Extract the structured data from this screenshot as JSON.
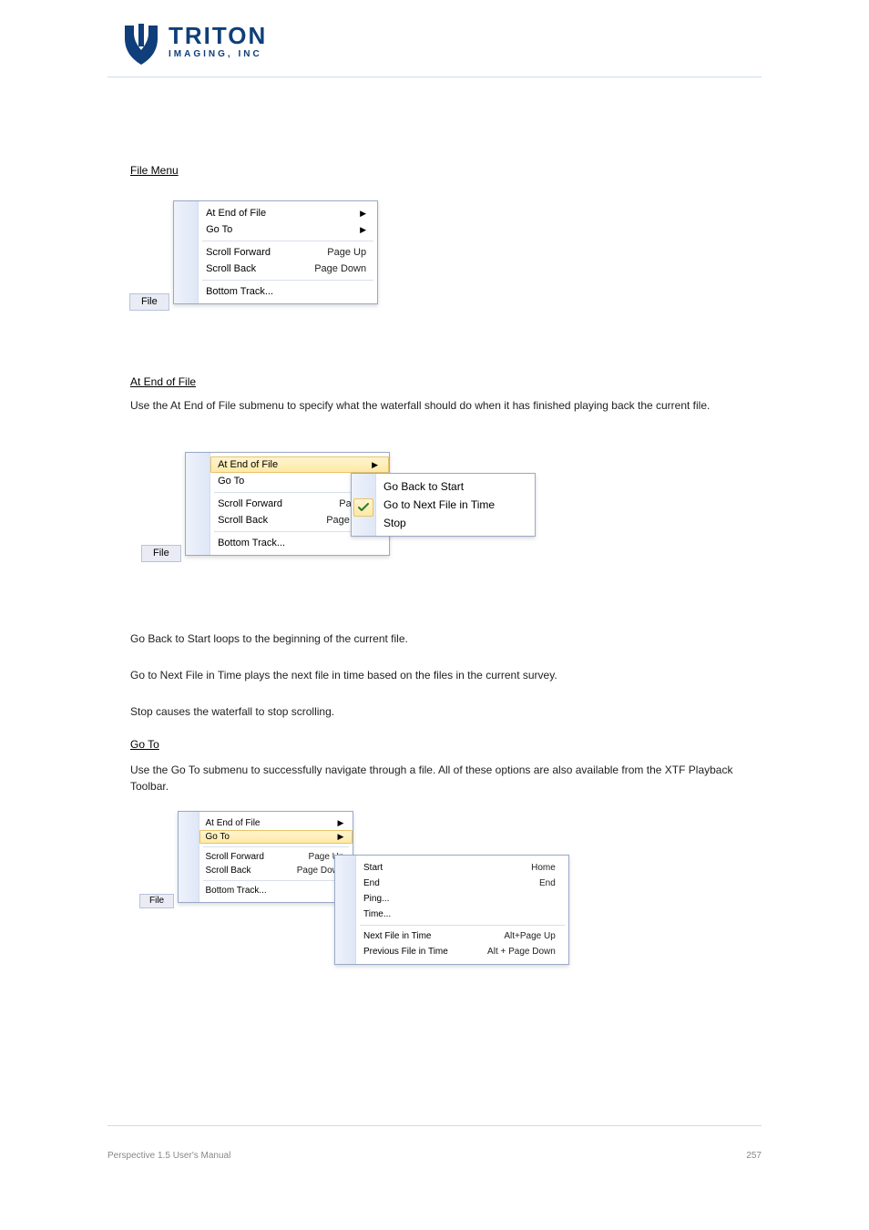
{
  "logo": {
    "line1": "TRITON",
    "line2": "IMAGING, INC"
  },
  "headings": {
    "file_menu": "File Menu",
    "at_end_of_file": "At End of File",
    "go_to": "Go To"
  },
  "descriptions": {
    "at_end_of_file_leadin": "Use the At End of File submenu to specify what the waterfall should do when it has finished playing back the current file.",
    "go_back_to_start_desc": "Go Back to Start loops to the beginning of the current file.",
    "go_to_next_file_desc": "Go to Next File in Time plays the next file in time based on the files in the current survey.",
    "stop_desc": "Stop causes the waterfall to stop scrolling.",
    "goto_leadin": "Use the Go To submenu to successfully navigate through a file. All of these options are also available from the XTF Playback Toolbar."
  },
  "file_label": "File",
  "file_menu": {
    "at_end_of_file": "At End of File",
    "go_to": "Go To",
    "scroll_forward": "Scroll Forward",
    "scroll_forward_accel": "Page Up",
    "scroll_back": "Scroll Back",
    "scroll_back_accel": "Page Down",
    "bottom_track": "Bottom Track..."
  },
  "eof_submenu": {
    "go_back_to_start": "Go Back to Start",
    "go_to_next_file": "Go to Next File in Time",
    "stop": "Stop"
  },
  "goto_submenu": {
    "start": "Start",
    "start_accel": "Home",
    "end": "End",
    "end_accel": "End",
    "ping": "Ping...",
    "time": "Time...",
    "next_file": "Next File in Time",
    "next_file_accel": "Alt+Page Up",
    "prev_file": "Previous File in Time",
    "prev_file_accel": "Alt + Page Down"
  },
  "footer": {
    "doc": "Perspective 1.5 User's Manual",
    "page": "257"
  }
}
